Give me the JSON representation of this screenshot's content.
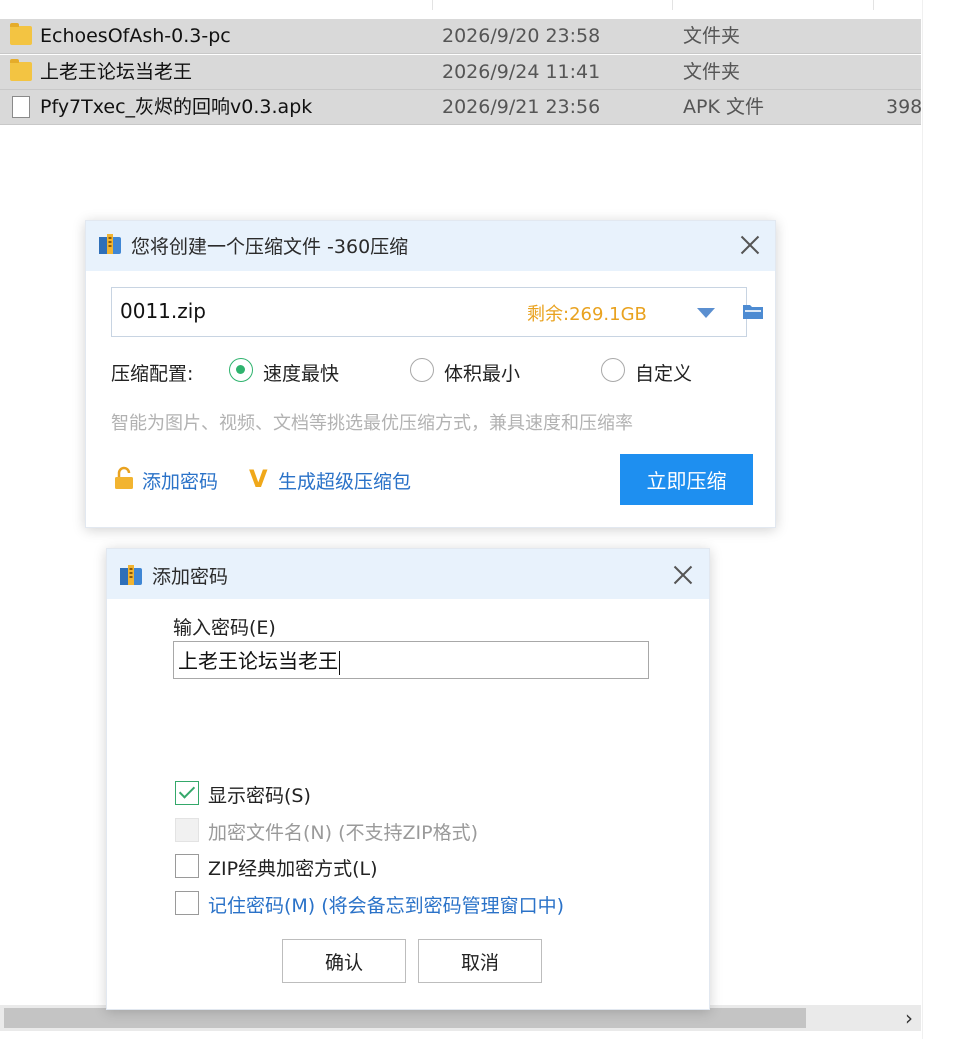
{
  "files": [
    {
      "name": "EchoesOfAsh-0.3-pc",
      "date": "2026/9/20 23:58",
      "type": "文件夹",
      "size": "",
      "icon": "folder-icon"
    },
    {
      "name": "上老王论坛当老王",
      "date": "2026/9/24 11:41",
      "type": "文件夹",
      "size": "",
      "icon": "folder-icon"
    },
    {
      "name": "Pfy7Txec_灰烬的回响v0.3.apk",
      "date": "2026/9/21 23:56",
      "type": "APK 文件",
      "size": "398",
      "icon": "file-icon"
    }
  ],
  "scrollbar": {
    "right_arrow": "›"
  },
  "compress_dialog": {
    "title": "您将创建一个压缩文件 -360压缩",
    "filename": "0011.zip",
    "free_space": "剩余:269.1GB",
    "config_label": "压缩配置:",
    "options": [
      "速度最快",
      "体积最小",
      "自定义"
    ],
    "selected_option": "速度最快",
    "hint": "智能为图片、视频、文档等挑选最优压缩方式，兼具速度和压缩率",
    "add_password": "添加密码",
    "super_package": "生成超级压缩包",
    "compress_now": "立即压缩"
  },
  "password_dialog": {
    "title": "添加密码",
    "input_label": "输入密码(E)",
    "password_value": "上老王论坛当老王",
    "options": [
      {
        "label": "显示密码(S)",
        "checked": true,
        "enabled": true
      },
      {
        "label": "加密文件名(N) (不支持ZIP格式)",
        "checked": false,
        "enabled": false
      },
      {
        "label": "ZIP经典加密方式(L)",
        "checked": false,
        "enabled": true
      },
      {
        "label": "记住密码(M) (将会备忘到密码管理窗口中)",
        "checked": false,
        "enabled": true
      }
    ],
    "confirm": "确认",
    "cancel": "取消"
  },
  "colors": {
    "accent": "#1e8ff0",
    "free_space": "#e9a21f",
    "check_green": "#2fb36e",
    "link_blue": "#2a72c8",
    "titlebar": "#e8f2fc",
    "row_highlight": "#d9d9d9"
  }
}
